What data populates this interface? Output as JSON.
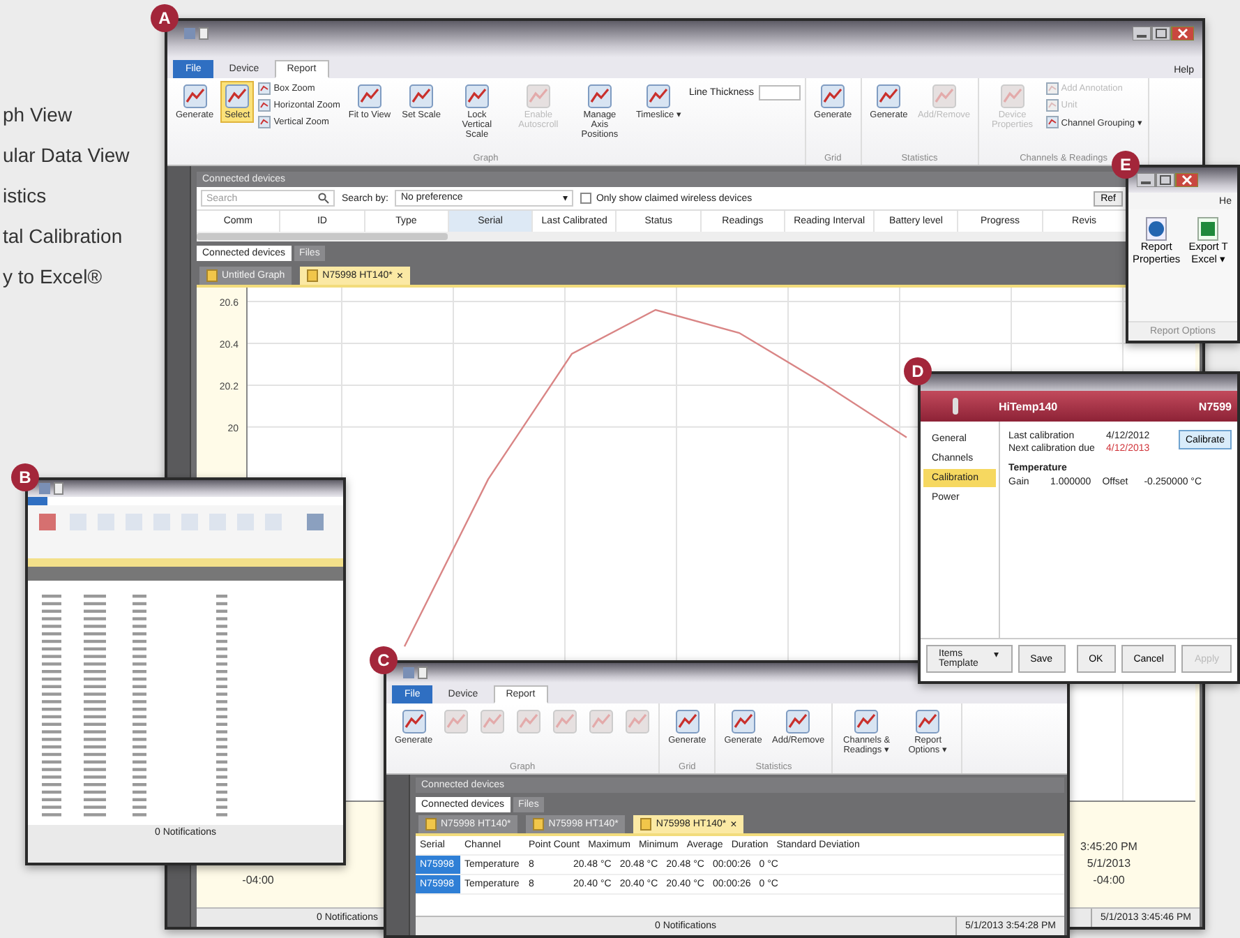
{
  "feature_list": [
    "ph View",
    "ular Data View",
    "istics",
    "tal Calibration",
    "y to Excel®"
  ],
  "main_window": {
    "badge": "A",
    "tabs": [
      {
        "label": "File",
        "kind": "file",
        "selected": false
      },
      {
        "label": "Device",
        "kind": "tab",
        "selected": false
      },
      {
        "label": "Report",
        "kind": "tab",
        "selected": true
      }
    ],
    "help": "Help",
    "ribbon_groups": [
      {
        "label": "Graph",
        "items": [
          {
            "kind": "large",
            "label": "Generate",
            "selected": false,
            "disabled": false
          },
          {
            "kind": "large",
            "label": "Select",
            "selected": true,
            "disabled": false
          },
          {
            "kind": "stack",
            "items": [
              {
                "label": "Box Zoom",
                "disabled": false
              },
              {
                "label": "Horizontal Zoom",
                "disabled": false
              },
              {
                "label": "Vertical Zoom",
                "disabled": false
              }
            ]
          },
          {
            "kind": "large",
            "label": "Fit to View",
            "selected": false,
            "disabled": false
          },
          {
            "kind": "large",
            "label": "Set Scale",
            "selected": false,
            "disabled": false
          },
          {
            "kind": "large",
            "label": "Lock Vertical Scale",
            "selected": false,
            "disabled": false
          },
          {
            "kind": "large",
            "label": "Enable Autoscroll",
            "selected": false,
            "disabled": true
          },
          {
            "kind": "large",
            "label": "Manage Axis Positions",
            "selected": false,
            "disabled": false
          },
          {
            "kind": "large",
            "label": "Timeslice ▾",
            "selected": false,
            "disabled": false
          },
          {
            "kind": "field",
            "label": "Line Thickness"
          }
        ]
      },
      {
        "label": "Grid",
        "items": [
          {
            "kind": "large",
            "label": "Generate",
            "selected": false,
            "disabled": false
          }
        ]
      },
      {
        "label": "Statistics",
        "items": [
          {
            "kind": "large",
            "label": "Generate",
            "selected": false,
            "disabled": false
          },
          {
            "kind": "large",
            "label": "Add/Remove",
            "selected": false,
            "disabled": true
          }
        ]
      },
      {
        "label": "Channels & Readings",
        "items": [
          {
            "kind": "large",
            "label": "Device Properties",
            "selected": false,
            "disabled": true
          },
          {
            "kind": "stack",
            "items": [
              {
                "label": "Add Annotation",
                "disabled": true
              },
              {
                "label": "Unit",
                "disabled": true
              },
              {
                "label": "Channel Grouping ▾",
                "disabled": false
              }
            ]
          }
        ]
      }
    ],
    "devices_panel": {
      "title": "Connected devices",
      "search_placeholder": "Search",
      "search_by_label": "Search by:",
      "search_by_value": "No preference",
      "search_by_caret": "▾",
      "wireless_filter": {
        "label": "Only show claimed wireless devices",
        "checked": false
      },
      "refresh_button": "Ref",
      "columns": [
        {
          "label": "Comm",
          "sorted": false
        },
        {
          "label": "ID",
          "sorted": false
        },
        {
          "label": "Type",
          "sorted": false
        },
        {
          "label": "Serial",
          "sorted": true
        },
        {
          "label": "Last Calibrated",
          "sorted": false
        },
        {
          "label": "Status",
          "sorted": false
        },
        {
          "label": "Readings",
          "sorted": false
        },
        {
          "label": "Reading Interval",
          "sorted": false
        },
        {
          "label": "Battery level",
          "sorted": false
        },
        {
          "label": "Progress",
          "sorted": false
        },
        {
          "label": "Revis",
          "sorted": false
        }
      ],
      "panel_tabs": [
        {
          "label": "Connected devices",
          "selected": true
        },
        {
          "label": "Files",
          "selected": false
        }
      ]
    },
    "doc_tabs": [
      {
        "label": "Untitled Graph",
        "selected": false
      },
      {
        "label": "N75998 HT140*",
        "selected": true,
        "close_glyph": "×"
      }
    ],
    "graph": {
      "chart_data": {
        "type": "line",
        "ylim": [
          18.21,
          20.667
        ],
        "yticks": [
          20,
          20.2,
          20.4,
          20.6
        ],
        "grid": true,
        "series": [
          {
            "color": "#d98585",
            "values": [
              null,
              18.95,
              19.75,
              20.35,
              20.56,
              20.45,
              20.21,
              19.95,
              null,
              null,
              null
            ]
          }
        ]
      },
      "x_axis_labels": [
        {
          "lines": [
            "-04:00"
          ]
        },
        {
          "lines": [
            "3:45:20 PM",
            "5/1/2013",
            "-04:00"
          ]
        }
      ]
    },
    "status_bar": {
      "notifications": "0 Notifications",
      "timestamp": "5/1/2013 3:45:46 PM"
    }
  },
  "tabular_window": {
    "badge": "B",
    "status": "0 Notifications"
  },
  "statistics_window": {
    "badge": "C",
    "tabs": [
      {
        "label": "File",
        "kind": "file",
        "selected": false
      },
      {
        "label": "Device",
        "kind": "tab",
        "selected": false
      },
      {
        "label": "Report",
        "kind": "tab",
        "selected": true
      }
    ],
    "ribbon_groups": [
      {
        "label": "Graph",
        "items": [
          {
            "kind": "large",
            "label": "Generate",
            "selected": false,
            "disabled": false
          },
          {
            "kind": "large",
            "selected": false,
            "disabled": true
          },
          {
            "kind": "large",
            "selected": false,
            "disabled": true
          },
          {
            "kind": "large",
            "selected": false,
            "disabled": true
          },
          {
            "kind": "large",
            "selected": false,
            "disabled": true
          },
          {
            "kind": "large",
            "selected": false,
            "disabled": true
          },
          {
            "kind": "large",
            "selected": false,
            "disabled": true
          }
        ]
      },
      {
        "label": "Grid",
        "items": [
          {
            "kind": "large",
            "label": "Generate",
            "selected": false,
            "disabled": false
          }
        ]
      },
      {
        "label": "Statistics",
        "items": [
          {
            "kind": "large",
            "label": "Generate",
            "selected": false,
            "disabled": false
          },
          {
            "kind": "large",
            "label": "Add/Remove",
            "selected": false,
            "disabled": false
          }
        ]
      },
      {
        "items": [
          {
            "kind": "large",
            "label": "Channels & Readings ▾",
            "selected": false,
            "disabled": false
          },
          {
            "kind": "large",
            "label": "Report Options ▾",
            "selected": false,
            "disabled": false
          }
        ]
      }
    ],
    "panel_title": "Connected devices",
    "panel_tabs": [
      {
        "label": "Connected devices",
        "selected": true
      },
      {
        "label": "Files",
        "selected": false
      }
    ],
    "doc_tabs": [
      {
        "label": "N75998 HT140*",
        "selected": false
      },
      {
        "label": "N75998 HT140*",
        "selected": false
      },
      {
        "label": "N75998 HT140*",
        "selected": true,
        "close_glyph": "×"
      }
    ],
    "columns": [
      "Serial",
      "Channel",
      "Point Count",
      "Maximum",
      "Minimum",
      "Average",
      "Duration",
      "Standard Deviation"
    ],
    "rows": [
      [
        "N75998",
        "Temperature",
        "8",
        "20.48 °C",
        "20.48 °C",
        "20.48 °C",
        "00:00:26",
        "0 °C"
      ],
      [
        "N75998",
        "Temperature",
        "8",
        "20.40 °C",
        "20.40 °C",
        "20.40 °C",
        "00:00:26",
        "0 °C"
      ]
    ],
    "status_bar": {
      "notifications": "0 Notifications",
      "timestamp": "5/1/2013 3:54:28 PM"
    }
  },
  "properties_dialog": {
    "badge": "D",
    "device_name": "HiTemp140",
    "serial": "N7599",
    "nav": [
      {
        "label": "General",
        "selected": false
      },
      {
        "label": "Channels",
        "selected": false
      },
      {
        "label": "Calibration",
        "selected": true
      },
      {
        "label": "Power",
        "selected": false
      }
    ],
    "fields": [
      {
        "label": "Last calibration",
        "value": "4/12/2012",
        "overdue": false
      },
      {
        "label": "Next calibration due",
        "value": "4/12/2013",
        "overdue": true
      }
    ],
    "calibrate_button": "Calibrate",
    "section": "Temperature",
    "params": [
      {
        "label": "Gain",
        "value": "1.000000"
      },
      {
        "label": "Offset",
        "value": "-0.250000 °C"
      }
    ],
    "template_dropdown": "Items Template",
    "template_caret": "▾",
    "buttons": [
      {
        "label": "Save",
        "disabled": false
      },
      {
        "label": "OK",
        "disabled": false
      },
      {
        "label": "Cancel",
        "disabled": false
      },
      {
        "label": "Apply",
        "disabled": true
      }
    ]
  },
  "report_options_window": {
    "badge": "E",
    "help": "He",
    "buttons": [
      {
        "lines": [
          "Report",
          "Properties"
        ],
        "kind": "properties"
      },
      {
        "lines": [
          "Export T",
          "Excel ▾"
        ],
        "kind": "excel"
      }
    ],
    "group": "Report Options"
  }
}
